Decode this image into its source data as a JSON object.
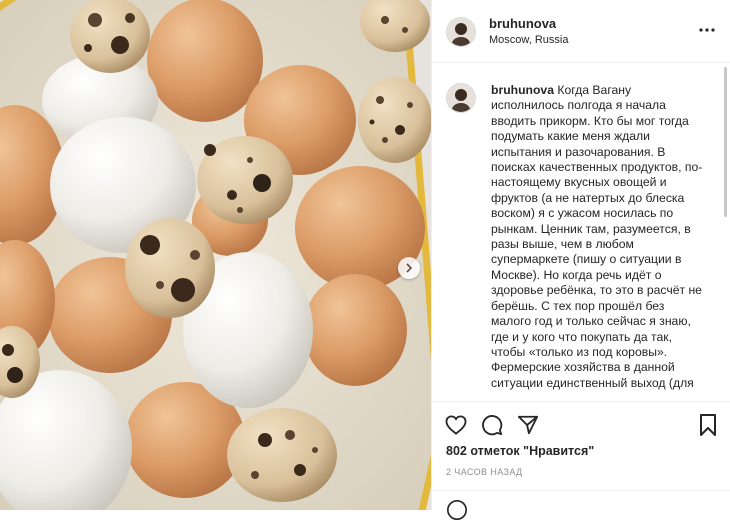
{
  "post": {
    "username": "bruhunova",
    "location": "Moscow, Russia"
  },
  "caption": {
    "username": "bruhunova",
    "text": "Когда Вагану исполнилось полгода я начала вводить прикорм. Кто бы мог тогда подумать какие меня ждали испытания и разочарования. В поисках качественных продуктов, по-настоящему вкусных овощей и фруктов (а не натертых до блеска воском) я с ужасом носилась по рынкам. Ценник там, разумеется, в разы выше, чем в любом супермаркете (пишу о ситуации в Москве). Но когда речь идёт о здоровье ребёнка, то это в расчёт не берёшь. С тех пор прошёл без малого год и только сейчас я знаю, где и у кого что покупать да так, чтобы «только из под коровы». Фермерские хозяйства в данной ситуации единственный выход (для"
  },
  "likes": {
    "count": "802",
    "label": "отметок \"Нравится\""
  },
  "timestamp": "2 ЧАСОВ НАЗАД",
  "icons": {
    "like": "heart-icon",
    "comment": "comment-icon",
    "share": "share-icon",
    "save": "bookmark-icon",
    "more": "more-icon",
    "next": "chevron-right-icon",
    "emoji": "emoji-icon"
  },
  "colors": {
    "text": "#262626",
    "muted": "#8e8e8e",
    "border": "#efefef",
    "tray": "#e0b840"
  }
}
